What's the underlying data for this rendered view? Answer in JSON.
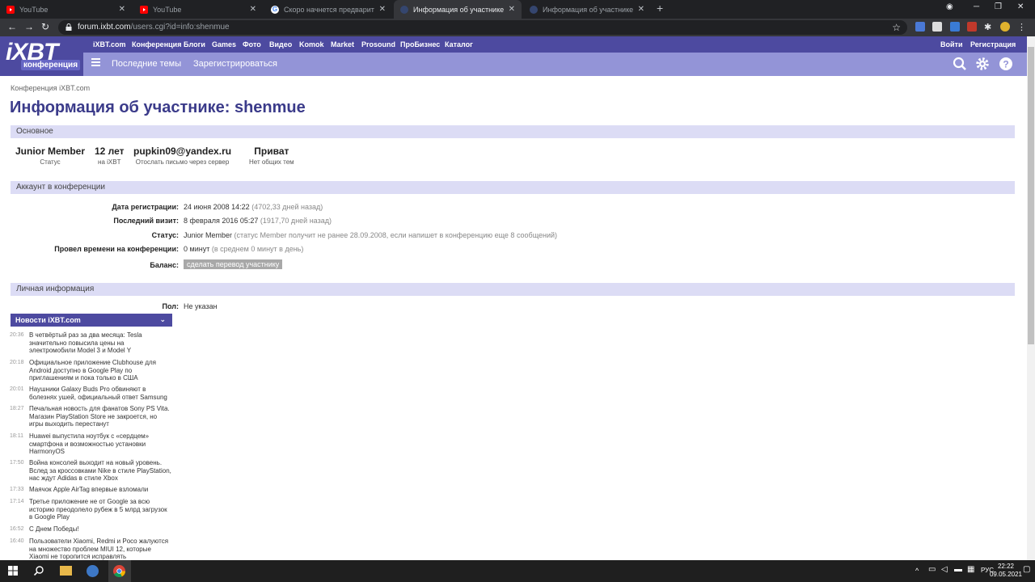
{
  "browser": {
    "tabs": [
      {
        "title": "YouTube",
        "icon": "youtube-icon"
      },
      {
        "title": "YouTube",
        "icon": "youtube-icon"
      },
      {
        "title": "Скоро начнется предварительн",
        "icon": "google-icon"
      },
      {
        "title": "Информация об участнике: she",
        "icon": "ixbt-icon"
      },
      {
        "title": "Информация об участнике: she",
        "icon": "ixbt-icon"
      }
    ],
    "url_host": "forum.ixbt.com",
    "url_path": "/users.cgi?id=info:shenmue"
  },
  "site": {
    "logo_main": "iXBT",
    "logo_sub": "конференция",
    "topnav": [
      "iXBT.com",
      "Конференция",
      "Блоги",
      "Games",
      "Фото",
      "Видео",
      "Komok",
      "Market",
      "Prosound",
      "ПроБизнес",
      "Каталог"
    ],
    "login": "Войти",
    "register_top": "Регистрация",
    "subnav": {
      "latest": "Последние темы",
      "register": "Зарегистрироваться"
    }
  },
  "page": {
    "breadcrumb": "Конференция iXBT.com",
    "title": "Информация об участнике: shenmue",
    "sections": {
      "basic": "Основное",
      "account": "Аккаунт в конференции",
      "personal": "Личная информация"
    },
    "stats": [
      {
        "value": "Junior Member",
        "label": "Статус"
      },
      {
        "value": "12 лет",
        "label": "на iXBT"
      },
      {
        "value": "pupkin09@yandex.ru",
        "label": "Отослать письмо через сервер"
      },
      {
        "value": "Приват",
        "label": "Нет общих тем"
      }
    ],
    "account": {
      "reg_label": "Дата регистрации:",
      "reg_value": "24 июня 2008 14:22",
      "reg_ago": "(4702,33 дней назад)",
      "visit_label": "Последний визит:",
      "visit_value": "8 февраля 2016 05:27",
      "visit_ago": "(1917,70 дней назад)",
      "status_label": "Статус:",
      "status_value": "Junior Member",
      "status_note": "(статус Member получит не ранее 28.09.2008, если напишет в конференцию еще 8 сообщений)",
      "time_label": "Провел времени на конференции:",
      "time_value": "0 минут",
      "time_note": "(в среднем 0 минут в день)",
      "balance_label": "Баланс:",
      "balance_button": "сделать перевод участнику"
    },
    "personal": {
      "gender_label": "Пол:",
      "gender_value": "Не указан"
    }
  },
  "news": {
    "header": "Новости iXBT.com",
    "items": [
      {
        "time": "20:36",
        "text": "В четвёртый раз за два месяца: Tesla значительно повысила цены на электромобили Model 3 и Model Y"
      },
      {
        "time": "20:18",
        "text": "Официальное приложение Clubhouse для Android доступно в Google Play по приглашениям и пока только в США"
      },
      {
        "time": "20:01",
        "text": "Наушники Galaxy Buds Pro обвиняют в болезнях ушей, официальный ответ Samsung"
      },
      {
        "time": "18:27",
        "text": "Печальная новость для фанатов Sony PS Vita. Магазин PlayStation Store не закроется, но игры выходить перестанут"
      },
      {
        "time": "18:11",
        "text": "Huawei выпустила ноутбук с «сердцем» смартфона и возможностью установки HarmonyOS"
      },
      {
        "time": "17:50",
        "text": "Война консолей выходит на новый уровень. Вслед за кроссовками Nike в стиле PlayStation, нас ждут Adidas в стиле Xbox"
      },
      {
        "time": "17:33",
        "text": "Маячок Apple AirTag впервые взломали"
      },
      {
        "time": "17:14",
        "text": "Третье приложение не от Google за всю историю преодолело рубеж в 5 млрд загрузок в Google Play"
      },
      {
        "time": "16:52",
        "text": "С Днем Победы!"
      },
      {
        "time": "16:40",
        "text": "Пользователи Xiaomi, Redmi и Poco жалуются на множество проблем MIUI 12, которые Xiaomi не торопится исправлять"
      }
    ]
  },
  "taskbar": {
    "lang": "РУС",
    "time": "22:22",
    "date": "09.05.2021"
  },
  "colors": {
    "brand": "#4d4aa0",
    "sub": "#9394d7",
    "section": "#dcdcf5",
    "title": "#3b3b8a"
  }
}
